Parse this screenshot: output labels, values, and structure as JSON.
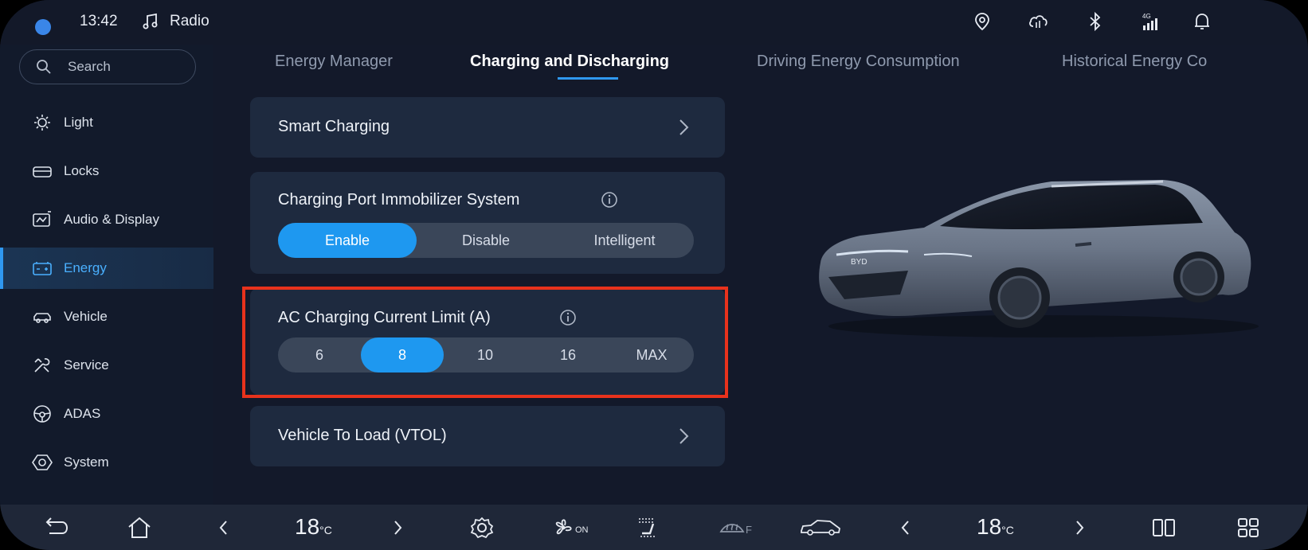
{
  "status_bar": {
    "time": "13:42",
    "media_label": "Radio",
    "icons": [
      "location-pin-icon",
      "cloud-sync-icon",
      "bluetooth-icon",
      "signal-4g-icon",
      "bell-icon"
    ]
  },
  "sidebar": {
    "search_label": "Search",
    "items": [
      {
        "label": "Light",
        "icon": "light-icon"
      },
      {
        "label": "Locks",
        "icon": "lock-icon"
      },
      {
        "label": "Audio & Display",
        "icon": "audio-display-icon"
      },
      {
        "label": "Energy",
        "icon": "battery-icon",
        "active": true
      },
      {
        "label": "Vehicle",
        "icon": "vehicle-icon"
      },
      {
        "label": "Service",
        "icon": "service-icon"
      },
      {
        "label": "ADAS",
        "icon": "steering-wheel-icon"
      },
      {
        "label": "System",
        "icon": "system-icon"
      }
    ]
  },
  "tabs": [
    {
      "label": "Energy Manager"
    },
    {
      "label": "Charging and Discharging",
      "active": true
    },
    {
      "label": "Driving Energy Consumption"
    },
    {
      "label": "Historical Energy Co"
    }
  ],
  "cards": {
    "smart_charging": {
      "title": "Smart Charging"
    },
    "immobilizer": {
      "title": "Charging Port Immobilizer System",
      "options": [
        "Enable",
        "Disable",
        "Intelligent"
      ],
      "selected": "Enable"
    },
    "ac_limit": {
      "title": "AC Charging Current Limit (A)",
      "options": [
        "6",
        "8",
        "10",
        "16",
        "MAX"
      ],
      "selected": "8"
    },
    "vtol": {
      "title": "Vehicle To Load (VTOL)"
    }
  },
  "bottom_bar": {
    "left_temp": "18",
    "right_temp": "18",
    "temp_unit": "°C",
    "fan_state": "ON",
    "defrost_label": "F"
  },
  "colors": {
    "accent": "#1e98f0",
    "highlight": "#e8321c",
    "background": "#13192a",
    "card": "#1e2a3f"
  }
}
